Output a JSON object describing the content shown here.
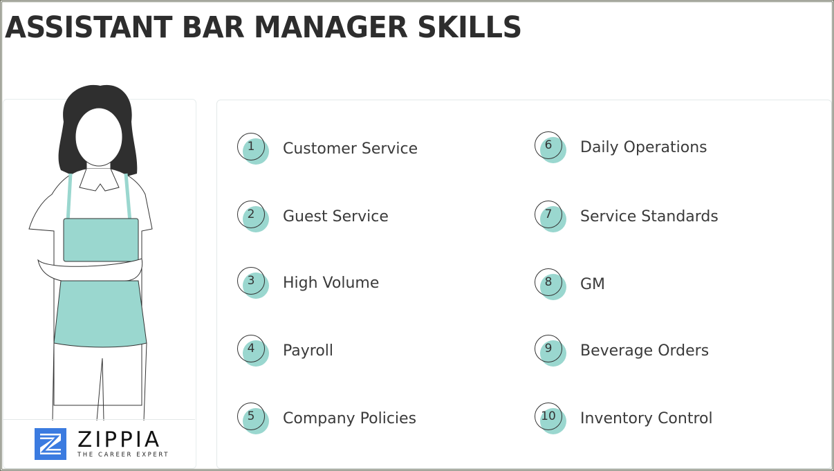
{
  "title": "ASSISTANT BAR MANAGER SKILLS",
  "brand": {
    "name": "ZIPPIA",
    "tagline": "THE CAREER EXPERT",
    "logo_color": "#3b7be0"
  },
  "accent_color": "#9ad7cf",
  "skills": [
    {
      "number": "1",
      "label": "Customer Service"
    },
    {
      "number": "2",
      "label": "Guest Service"
    },
    {
      "number": "3",
      "label": "High Volume"
    },
    {
      "number": "4",
      "label": "Payroll"
    },
    {
      "number": "5",
      "label": "Company Policies"
    },
    {
      "number": "6",
      "label": "Daily Operations"
    },
    {
      "number": "7",
      "label": "Service Standards"
    },
    {
      "number": "8",
      "label": "GM"
    },
    {
      "number": "9",
      "label": "Beverage Orders"
    },
    {
      "number": "10",
      "label": "Inventory Control"
    }
  ]
}
